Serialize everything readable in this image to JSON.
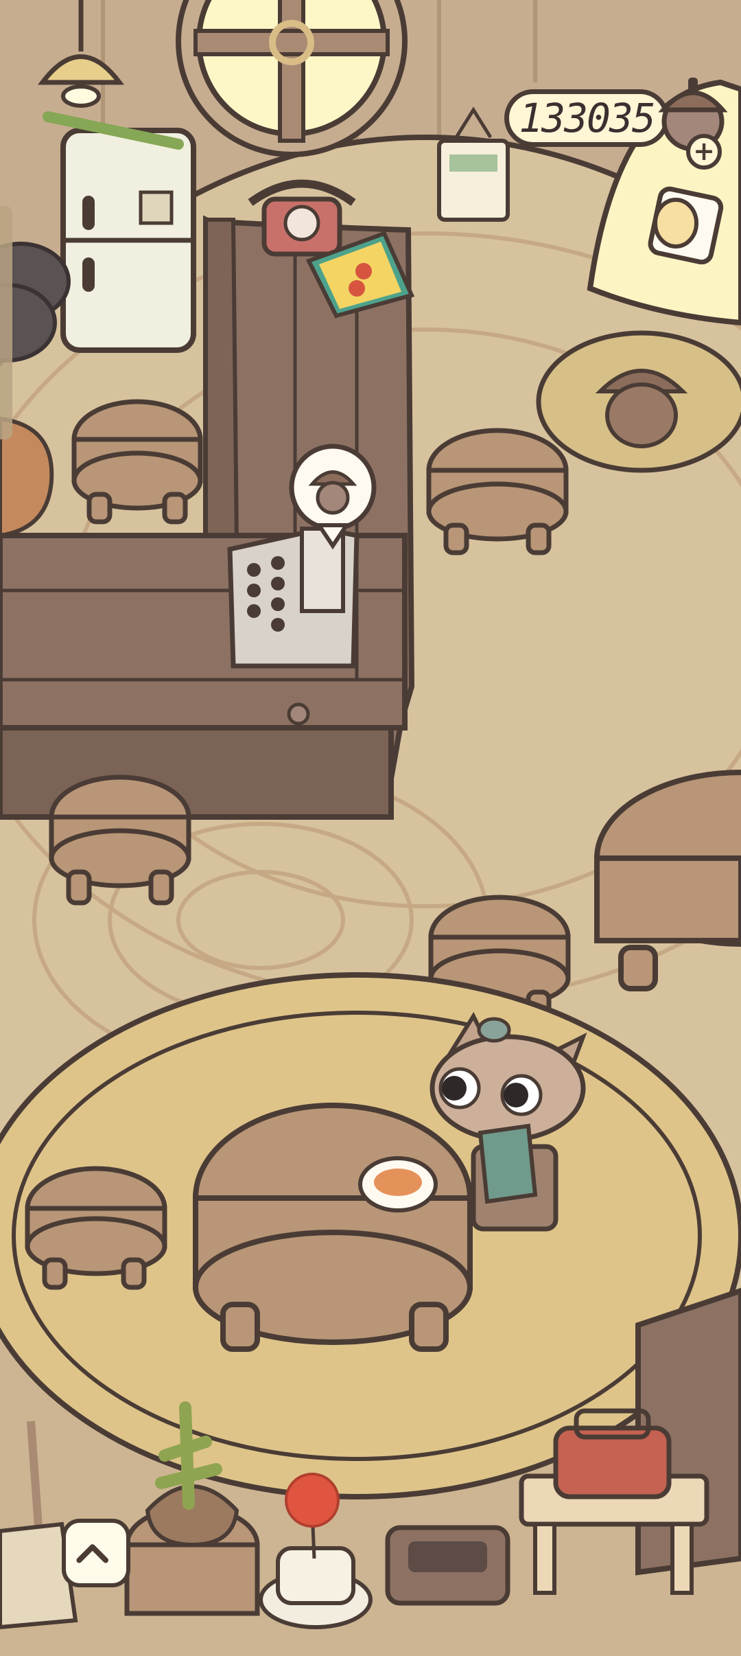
{
  "currency": {
    "acorns": "133035",
    "icon": "acorn-icon",
    "add_icon": "plus-icon"
  },
  "npc_speech": {
    "icon": "acorn-icon"
  },
  "expand_button": {
    "icon": "chevron-up-icon"
  },
  "colors": {
    "outline": "#4a3c35",
    "floor": "#d7c29e",
    "rug": "#dfc48a",
    "wood_light": "#b89677",
    "wood_dark": "#8d7264",
    "wall": "#c7ad90",
    "hud_bg": "#fff6d6"
  }
}
